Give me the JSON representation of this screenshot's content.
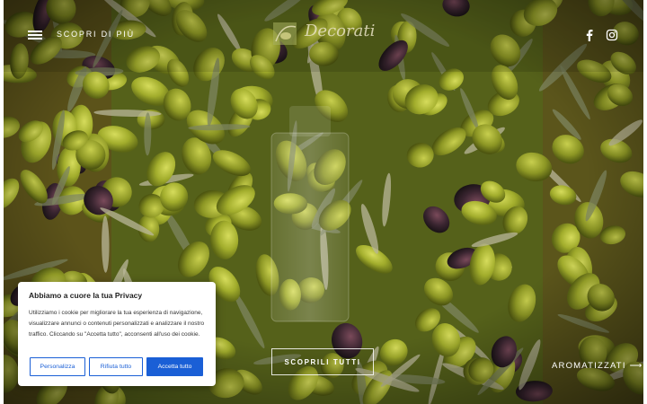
{
  "header": {
    "menu_label": "SCOPRI DI PIÙ",
    "logo_text": "Decorati",
    "social": [
      {
        "name": "facebook-icon"
      },
      {
        "name": "instagram-icon"
      }
    ]
  },
  "hero": {
    "cta_main": "SCOPRILI TUTTI",
    "cta_side": "AROMATIZZATI",
    "cta_side_arrow": "⟶"
  },
  "cookie": {
    "title": "Abbiamo a cuore la tua Privacy",
    "body": "Utilizziamo i cookie per migliorare la tua esperienza di navigazione, visualizzare annunci o contenuti personalizzati e analizzare il nostro traffico. Cliccando su \"Accetta tutto\", acconsenti all'uso dei cookie.",
    "buttons": {
      "customize": "Personalizza",
      "reject": "Rifiuta tutto",
      "accept": "Accetta tutto"
    }
  },
  "colors": {
    "accent_button": "#1a5fd6",
    "hero_base": "#4a5a18"
  }
}
